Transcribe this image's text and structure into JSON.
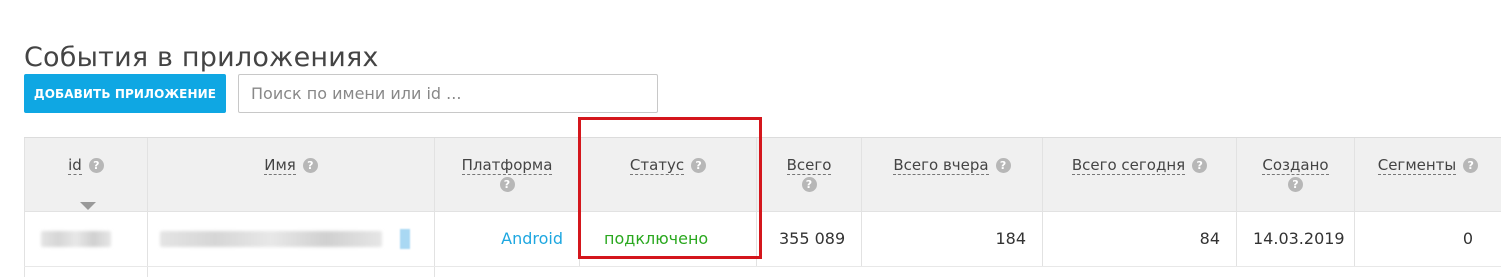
{
  "page": {
    "title": "События в приложениях"
  },
  "toolbar": {
    "add_button_label": "ДОБАВИТЬ ПРИЛОЖЕНИЕ",
    "search_placeholder": "Поиск по имени или id ..."
  },
  "table": {
    "help_glyph": "?",
    "columns": [
      {
        "label": "id"
      },
      {
        "label": "Имя"
      },
      {
        "label": "Платформа"
      },
      {
        "label": "Статус"
      },
      {
        "label": "Всего"
      },
      {
        "label": "Всего вчера"
      },
      {
        "label": "Всего сегодня"
      },
      {
        "label": "Создано"
      },
      {
        "label": "Сегменты"
      }
    ],
    "rows": [
      {
        "platform": "Android",
        "status": "подключено",
        "total": "355 089",
        "total_yesterday": "184",
        "total_today": "84",
        "created": "14.03.2019",
        "segments": "0"
      }
    ]
  },
  "colors": {
    "accent": "#0fa7e3",
    "link": "#1ea7e0",
    "status_ok": "#2aa81f",
    "highlight": "#d4161c"
  },
  "icons": {
    "help": "question-circle-icon",
    "sort": "sort-descending-icon"
  }
}
